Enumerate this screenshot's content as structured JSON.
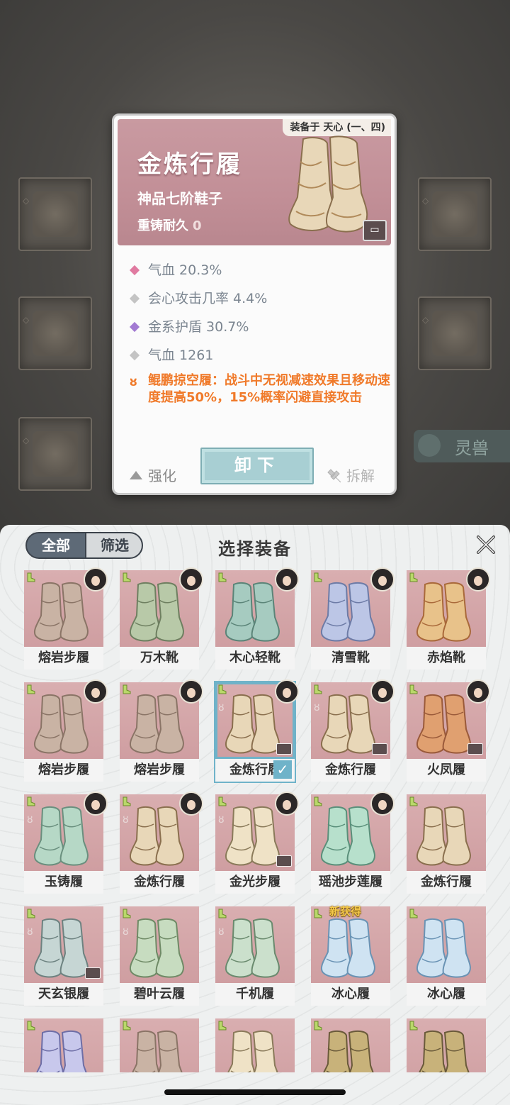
{
  "detail": {
    "equipped_to": "装备于 天心 (一、四)",
    "name": "金炼行履",
    "grade": "神品七阶鞋子",
    "durability_label": "重铸耐久",
    "durability_value": "0",
    "stats": [
      {
        "text": "气血 20.3%",
        "color": "#e07aa0"
      },
      {
        "text": "会心攻击几率 4.4%",
        "color": "#c4c4c4"
      },
      {
        "text": "金系护盾 30.7%",
        "color": "#a27ad2"
      },
      {
        "text": "气血 1261",
        "color": "#c4c4c4"
      }
    ],
    "special": "鲲鹏掠空履：战斗中无视减速效果且移动速度提高50%，15%概率闪避直接攻击",
    "enhance_label": "强化",
    "unequip_label": "卸下",
    "dismantle_label": "拆解"
  },
  "background": {
    "pet_label": "灵兽"
  },
  "panel": {
    "title": "选择装备",
    "tab_all": "全部",
    "tab_filter": "筛选",
    "new_tag": "新获得",
    "items": [
      "熔岩步履",
      "万木靴",
      "木心轻靴",
      "清雪靴",
      "赤焰靴",
      "熔岩步履",
      "熔岩步履",
      "金炼行履",
      "金炼行履",
      "火凤履",
      "玉铸履",
      "金炼行履",
      "金光步履",
      "瑶池步莲履",
      "金炼行履",
      "天玄银履",
      "碧叶云履",
      "千机履",
      "冰心履",
      "冰心履",
      "",
      "",
      "",
      "",
      ""
    ],
    "selected_index": 7
  },
  "colors": {
    "rose": "#cf9ea1",
    "accent": "#6fb3c9",
    "special_text": "#f07a2a"
  }
}
